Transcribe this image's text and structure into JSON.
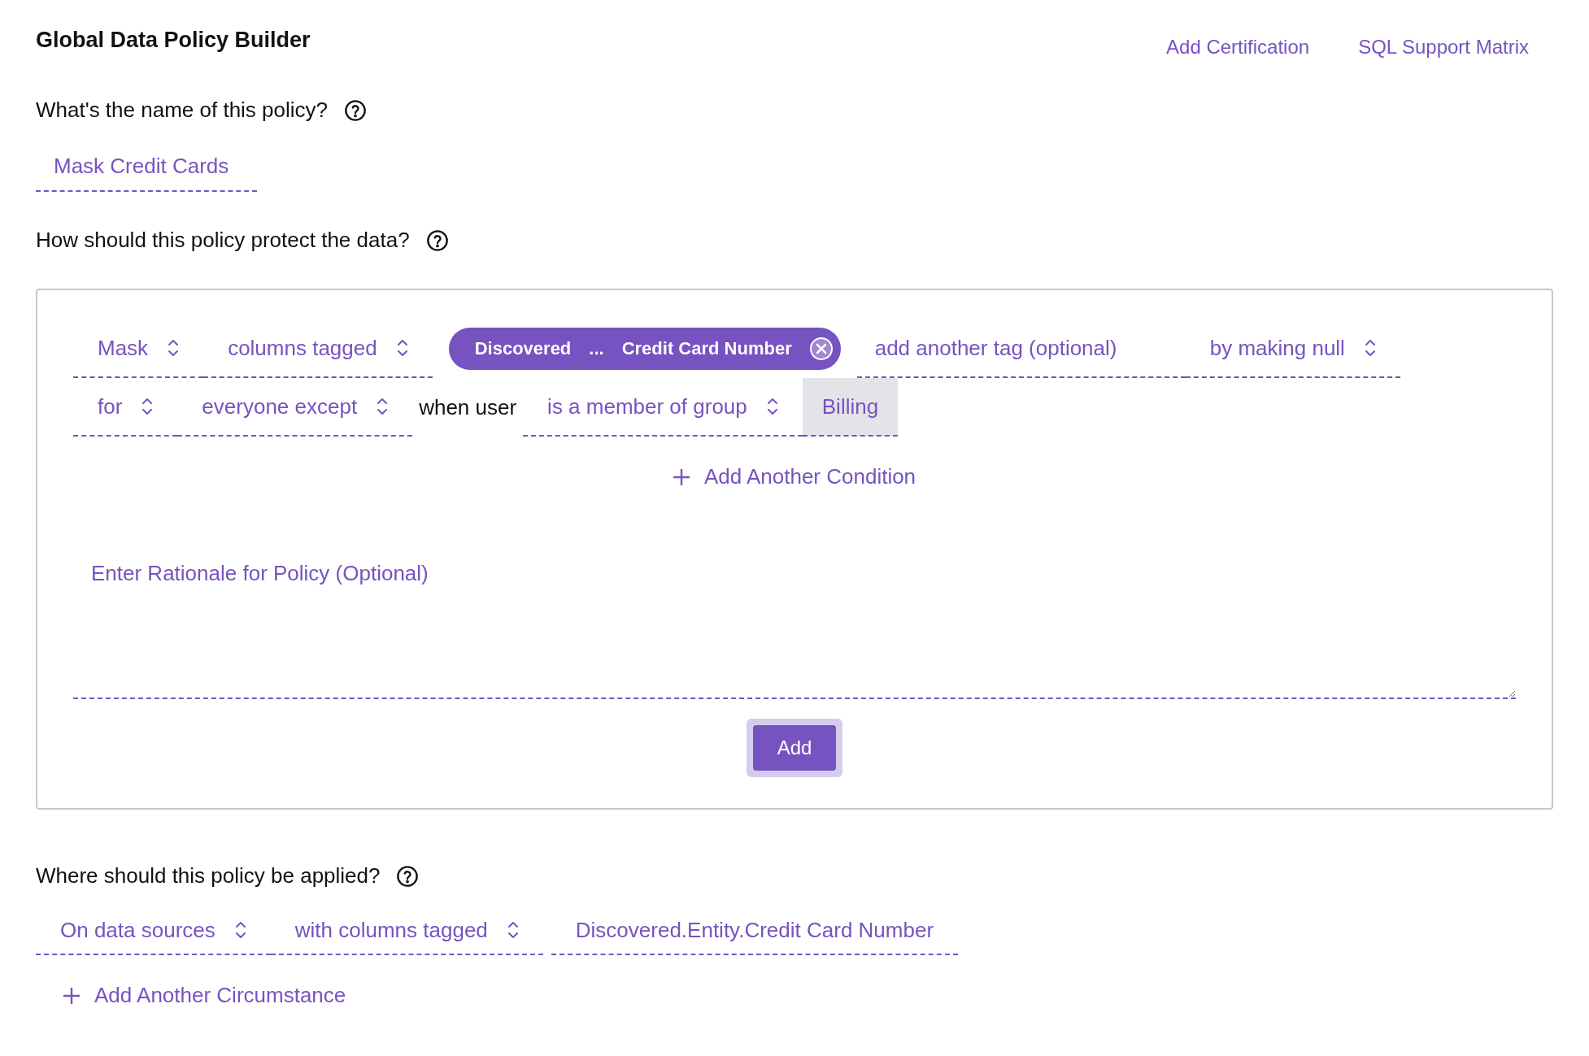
{
  "title": "Global Data Policy Builder",
  "header_links": [
    "Add Certification",
    "SQL Support Matrix"
  ],
  "name_section": {
    "question": "What's the name of this policy?",
    "value": "Mask Credit Cards"
  },
  "protect_section": {
    "question": "How should this policy protect the data?",
    "rule_lines": [
      {
        "parts": [
          {
            "kind": "select",
            "label": "Mask"
          },
          {
            "kind": "select",
            "label": "columns tagged"
          },
          {
            "kind": "chip",
            "parts": [
              "Discovered",
              "...",
              "Credit Card Number"
            ]
          },
          {
            "kind": "input",
            "placeholder": "add another tag (optional)"
          },
          {
            "kind": "select",
            "label": "by making null"
          }
        ]
      },
      {
        "parts": [
          {
            "kind": "select",
            "label": "for"
          },
          {
            "kind": "select",
            "label": "everyone except"
          },
          {
            "kind": "text",
            "label": "when user"
          },
          {
            "kind": "select",
            "label": "is a member of group"
          },
          {
            "kind": "tag",
            "label": "Billing"
          }
        ]
      }
    ],
    "add_condition": "Add Another Condition",
    "rationale": {
      "placeholder": "Enter Rationale for Policy (Optional)"
    },
    "add_button": "Add"
  },
  "apply_section": {
    "question": "Where should this policy be applied?",
    "items": [
      {
        "kind": "select",
        "label": "On data sources"
      },
      {
        "kind": "select",
        "label": "with columns tagged"
      },
      {
        "kind": "value",
        "label": "Discovered.Entity.Credit Card Number"
      }
    ],
    "add_circumstance": "Add Another Circumstance"
  }
}
